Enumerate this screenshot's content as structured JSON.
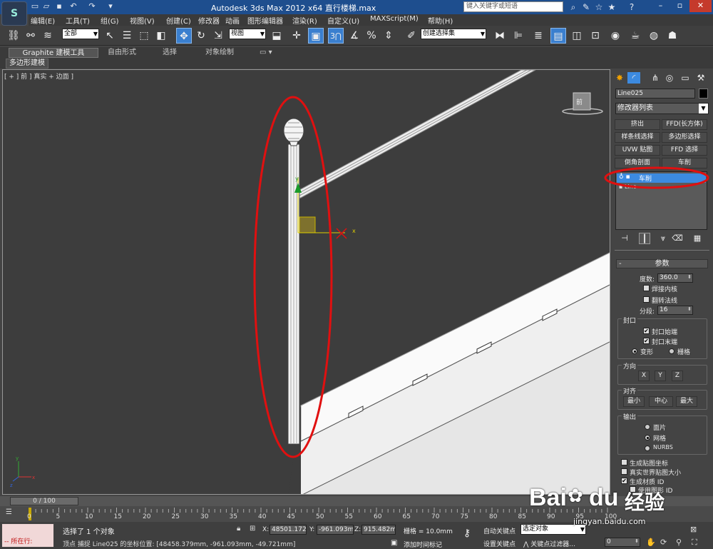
{
  "titlebar": {
    "title": "Autodesk 3ds Max  2012 x64      直行楼梯.max",
    "search_placeholder": "键入关键字或短语",
    "quick_access_icons": [
      "new-file-icon",
      "open-icon",
      "save-icon",
      "undo-icon",
      "redo-icon",
      "dropdown-icon"
    ],
    "right_icons": [
      "binoculars-icon",
      "tools-icon",
      "star-icon",
      "favorites-icon",
      "help-icon"
    ]
  },
  "menu": [
    "编辑(E)",
    "工具(T)",
    "组(G)",
    "视图(V)",
    "创建(C)",
    "修改器",
    "动画",
    "图形编辑器",
    "渲染(R)",
    "自定义(U)",
    "MAXScript(M)",
    "帮助(H)"
  ],
  "toolbar": {
    "selection_filter": "全部",
    "ref_coord": "视图",
    "named_selection": "创建选择集",
    "snap_label": "3"
  },
  "ribbon": {
    "tabs": [
      "Graphite 建模工具",
      "自由形式",
      "选择",
      "对象绘制"
    ],
    "subtab": "多边形建模"
  },
  "viewport": {
    "label": "[ + ] 前 ] 真实 + 边面 ]",
    "viewcube_label": "前",
    "gizmo_x": "x",
    "gizmo_y": "y",
    "axis_x": "x",
    "axis_y": "y",
    "axis_z": "z"
  },
  "command_panel": {
    "object_name": "Line025",
    "object_color": "#000000",
    "modifier_list": "修改器列表",
    "modifier_buttons": [
      "挤出",
      "FFD(长方体)",
      "样条线选择",
      "多边形选择",
      "UVW 贴图",
      "FFD 选择",
      "倒角剖面",
      "车削"
    ],
    "stack": [
      "车削",
      "Line"
    ],
    "params_title": "参数",
    "degrees_label": "度数:",
    "degrees_value": "360.0",
    "weld_core": "焊接内核",
    "flip_normals": "翻转法线",
    "segments_label": "分段:",
    "segments_value": "16",
    "capping_title": "封口",
    "cap_start": "封口始端",
    "cap_end": "封口末端",
    "morph": "变形",
    "grid": "栅格",
    "direction_title": "方向",
    "dir_x": "X",
    "dir_y": "Y",
    "dir_z": "Z",
    "align_title": "对齐",
    "align_min": "最小",
    "align_center": "中心",
    "align_max": "最大",
    "output_title": "输出",
    "out_patch": "面片",
    "out_mesh": "网格",
    "out_nurbs": "NURBS",
    "gen_mapping": "生成贴图坐标",
    "real_world": "真实世界贴图大小",
    "gen_mat_ids": "生成材质 ID",
    "use_shape_ids": "使用图形 ID"
  },
  "timeline": {
    "frame": "0 / 100",
    "ticks": [
      "0",
      "5",
      "10",
      "15",
      "20",
      "25",
      "30",
      "35",
      "40",
      "45",
      "50",
      "55",
      "60",
      "65",
      "70",
      "75",
      "80",
      "85",
      "90",
      "95",
      "100"
    ]
  },
  "status": {
    "maxscript_text": "所在行:",
    "selected": "选择了 1 个对象",
    "prompt": "顶点 捕捉 Line025 的坐标位置: [48458.379mm, -961.093mm, -49.721mm]",
    "x_label": "X:",
    "x_value": "48501.172",
    "y_label": "Y:",
    "y_value": "-961.093m",
    "z_label": "Z:",
    "z_value": "915.482mr",
    "grid": "栅格 = 10.0mm",
    "add_tag": "添加时间标记",
    "auto_key": "自动关键点",
    "set_key": "设置关键点",
    "selected_obj": "选定对象",
    "key_filters": "关键点过滤器...",
    "frame_value": "0"
  },
  "watermark": {
    "brand": "Bai",
    "brand2": "du",
    "cn": "经验",
    "url": "jingyan.baidu.com"
  },
  "colors": {
    "title_blue": "#1e4e8e",
    "selection_blue": "#3c8ae0",
    "annotation_red": "#e01010",
    "viewport_border": "#c8a800"
  }
}
